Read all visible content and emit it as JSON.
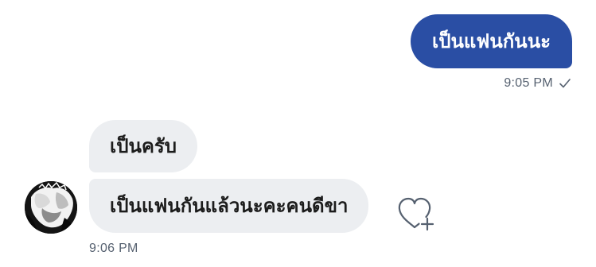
{
  "messages": {
    "outgoing": [
      {
        "text": "เป็นแฟนกันนะ",
        "time": "9:05 PM",
        "status_icon": "check-icon"
      }
    ],
    "incoming": [
      {
        "text": "เป็นครับ"
      },
      {
        "text": "เป็นแฟนกันแล้วนะคะคนดีขา"
      }
    ],
    "incoming_time": "9:06 PM"
  },
  "icons": {
    "reaction": "heart-plus-icon",
    "avatar": "avatar"
  },
  "colors": {
    "outgoing_bubble": "#2a4ea4",
    "incoming_bubble": "#eceef1",
    "timestamp": "#566170"
  }
}
